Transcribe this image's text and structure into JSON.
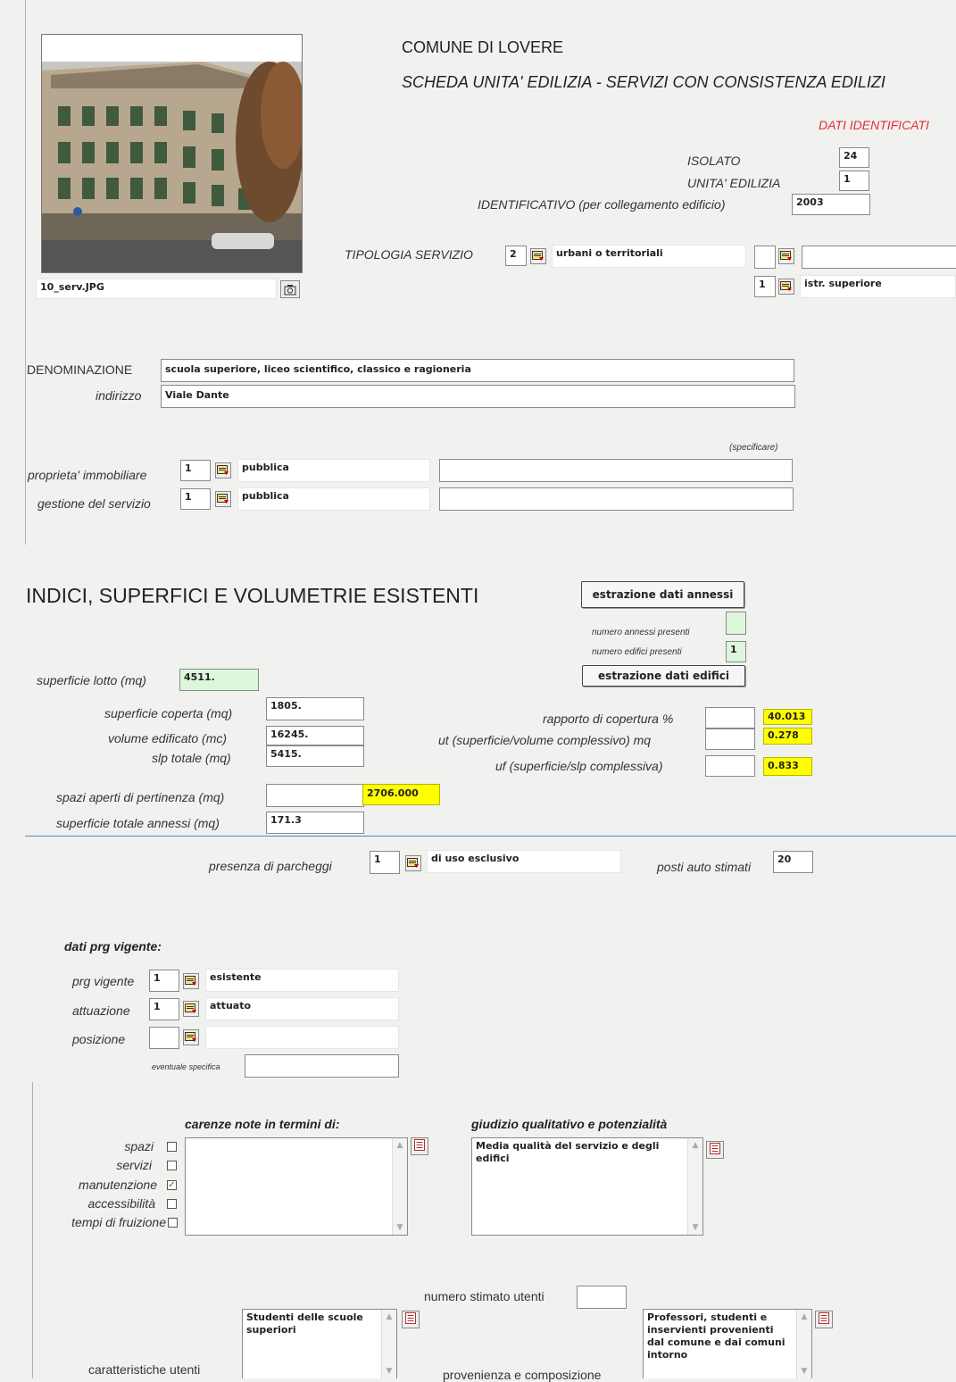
{
  "header": {
    "comune": "COMUNE DI LOVERE",
    "scheda": "SCHEDA UNITA' EDILIZIA - SERVIZI CON CONSISTENZA EDILIZI",
    "dati_identificativi": "DATI IDENTIFICATI"
  },
  "photo": {
    "filename": "10_serv.JPG"
  },
  "ident": {
    "isolato_label": "ISOLATO",
    "isolato": "24",
    "unita_label": "UNITA' EDILIZIA",
    "unita": "1",
    "identificativo_label": "IDENTIFICATIVO (per collegamento edificio)",
    "identificativo": "2003"
  },
  "tipologia": {
    "label": "TIPOLOGIA SERVIZIO",
    "code": "2",
    "desc": "urbani o territoriali",
    "code2": "",
    "desc2": "",
    "code3": "1",
    "desc3": "istr. superiore"
  },
  "denominazione": {
    "label": "DENOMINAZIONE",
    "value": "scuola superiore, liceo scientifico, classico e ragioneria"
  },
  "indirizzo": {
    "label": "indirizzo",
    "value": "Viale Dante"
  },
  "specificare": "(specificare)",
  "proprieta": {
    "label": "proprieta' immobiliare",
    "code": "1",
    "desc": "pubblica",
    "spec": ""
  },
  "gestione": {
    "label": "gestione del servizio",
    "code": "1",
    "desc": "pubblica",
    "spec": ""
  },
  "indici": {
    "title": "INDICI, SUPERFICI E VOLUMETRIE ESISTENTI",
    "btn_annessi": "estrazione dati annessi",
    "btn_edifici": "estrazione dati edifici",
    "annessi_label": "numero annessi presenti",
    "annessi": "",
    "edifici_label": "numero edifici presenti",
    "edifici": "1",
    "lotto_label": "superficie lotto (mq)",
    "lotto": "4511.",
    "coperta_label": "superficie coperta (mq)",
    "coperta": "1805.",
    "volume_label": "volume edificato (mc)",
    "volume": "16245.",
    "slp_label": "slp totale (mq)",
    "slp": "5415.",
    "rapporto_label": "rapporto di copertura %",
    "rapporto": "40.013",
    "ut_label": "ut (superficie/volume complessivo) mq",
    "ut": "0.278",
    "uf_label": "uf (superficie/slp complessiva)",
    "uf": "0.833",
    "spazi_label": "spazi aperti di pertinenza (mq)",
    "spazi": "2706.000",
    "annessi_tot_label": "superficie totale annessi (mq)",
    "annessi_tot": "171.3"
  },
  "parcheggi": {
    "label": "presenza di parcheggi",
    "code": "1",
    "desc": "di uso esclusivo",
    "posti_label": "posti auto stimati",
    "posti": "20"
  },
  "prg": {
    "title": "dati prg vigente:",
    "vigente_label": "prg vigente",
    "vigente_code": "1",
    "vigente_desc": "esistente",
    "attuazione_label": "attuazione",
    "attuazione_code": "1",
    "attuazione_desc": "attuato",
    "posizione_label": "posizione",
    "posizione_code": "",
    "posizione_desc": "",
    "specifica_label": "eventuale specifica",
    "specifica": ""
  },
  "carenze": {
    "title": "carenze note in termini di:",
    "items": [
      "spazi",
      "servizi",
      "manutenzione",
      "accessibilità",
      "tempi di fruizione"
    ],
    "checked": [
      false,
      false,
      true,
      false,
      false
    ],
    "note": ""
  },
  "giudizio": {
    "title": "giudizio qualitativo e potenzialità",
    "text": "Media qualità del servizio e degli edifici"
  },
  "utenti": {
    "numero_label": "numero stimato utenti",
    "numero": "",
    "caratteristiche_label": "caratteristiche utenti",
    "caratteristiche": "Studenti delle scuole superiori",
    "provenienza_label": "provenienza e composizione",
    "provenienza": "Professori, studenti e inservienti provenienti dal comune e dai comuni intorno"
  }
}
